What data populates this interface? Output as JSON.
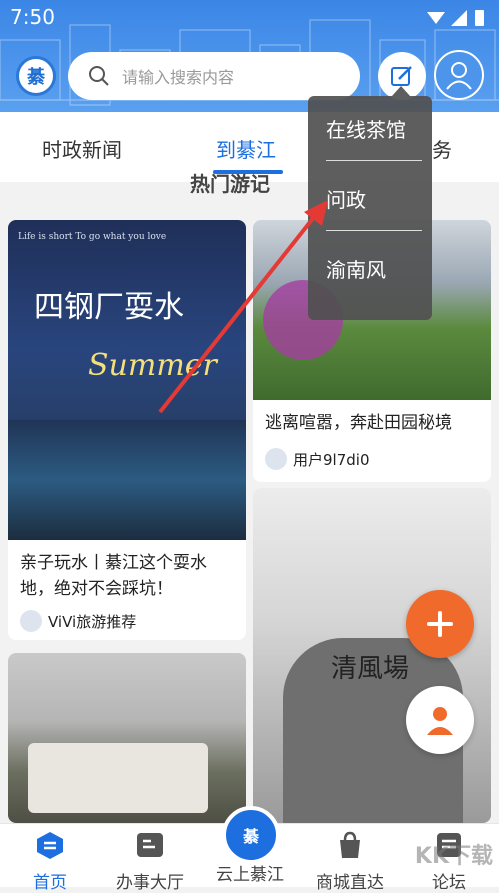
{
  "status_bar": {
    "time": "7:50"
  },
  "header": {
    "logo_text": "綦",
    "search_placeholder": "请输入搜索内容"
  },
  "tabs": [
    {
      "label": "时政新闻",
      "active": false
    },
    {
      "label": "到綦江",
      "active": true
    },
    {
      "label": "务",
      "active": false
    }
  ],
  "section_title": "热门游记",
  "cards": [
    {
      "overlay_line": "Life is short  To go what you love",
      "overlay_title": "四钢厂耍水",
      "overlay_sub": "Summer",
      "title": "亲子玩水丨綦江这个耍水地，绝对不会踩坑！",
      "author": "ViVi旅游推荐"
    },
    {
      "title": "逃离喧嚣，奔赴田园秘境",
      "author": "用户9l7di0"
    },
    {
      "title": ""
    },
    {
      "sign_text": "清風場"
    }
  ],
  "dropdown": {
    "items": [
      "在线茶馆",
      "问政",
      "渝南风"
    ]
  },
  "bottom_nav": [
    {
      "label": "首页",
      "active": true
    },
    {
      "label": "办事大厅",
      "active": false
    },
    {
      "label": "云上綦江",
      "active": false
    },
    {
      "label": "商城直达",
      "active": false
    },
    {
      "label": "论坛",
      "active": false
    }
  ],
  "center_logo": "綦",
  "watermark": "KK下载",
  "colors": {
    "primary": "#1d6fe0",
    "header": "#3b86e6",
    "fab": "#f06a2c",
    "arrow": "#e53935"
  }
}
